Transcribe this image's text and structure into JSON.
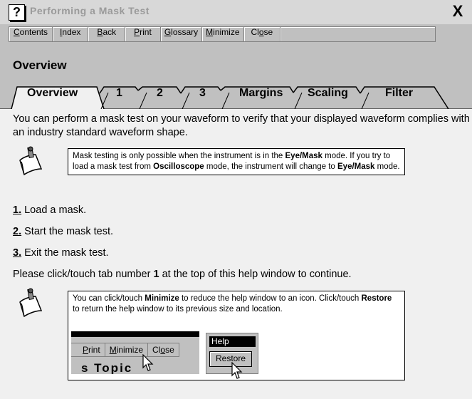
{
  "window": {
    "title": "Performing a Mask Test",
    "help_icon": "?",
    "close_label": "X"
  },
  "buttons": [
    "Contents",
    "Index",
    "Back",
    "Print",
    "Glossary",
    "Minimize",
    "Close"
  ],
  "section_heading": "Overview",
  "tabs": [
    "Overview",
    "1",
    "2",
    "3",
    "Margins",
    "Scaling",
    "Filter"
  ],
  "intro": "You can perform a mask test on your waveform to verify that your displayed waveform complies with an industry standard waveform shape.",
  "note1": {
    "t1": "Mask testing is only possible when the instrument is in the ",
    "b1": "Eye/Mask",
    "t2": " mode. If you try to load a mask test from ",
    "b2": "Oscilloscope",
    "t3": " mode, the instrument will change to ",
    "b3": "Eye/Mask",
    "t4": " mode."
  },
  "steps": [
    {
      "num": "1.",
      "text": " Load a mask."
    },
    {
      "num": "2.",
      "text": " Start the mask test."
    },
    {
      "num": "3.",
      "text": " Exit the mask test."
    }
  ],
  "instruction": {
    "t1": "Please click/touch tab number ",
    "b1": "1",
    "t2": " at the top of this help window to continue."
  },
  "note2": {
    "t1": "You can click/touch ",
    "b1": "Minimize",
    "t2": " to reduce the help window to an icon. Click/touch ",
    "b2": "Restore",
    "t3": " to return the help window to its previous size and location."
  },
  "illustration": {
    "buttons": [
      "Print",
      "Minimize",
      "Close"
    ],
    "topic_fragment": "s Topic",
    "help_label": "Help",
    "restore_label": "Restore"
  },
  "icons": {
    "note": "pencil-note-icon",
    "cursor": "arrow-cursor-icon"
  }
}
